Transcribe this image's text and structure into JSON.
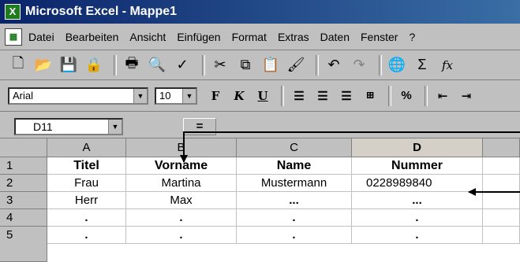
{
  "window": {
    "title": "Microsoft Excel - Mappe1",
    "app_icon": "X"
  },
  "menu": {
    "items": [
      "Datei",
      "Bearbeiten",
      "Ansicht",
      "Einfügen",
      "Format",
      "Extras",
      "Daten",
      "Fenster",
      "?"
    ]
  },
  "toolbar": {
    "icons": [
      "new-icon",
      "open-icon",
      "save-icon",
      "permission-icon",
      "print-icon",
      "print-preview-icon",
      "spelling-icon",
      "cut-icon",
      "copy-icon",
      "paste-icon",
      "format-painter-icon",
      "undo-icon",
      "redo-icon",
      "hyperlink-icon",
      "autosum-icon",
      "function-icon"
    ]
  },
  "formatting": {
    "font": "Arial",
    "size": "10",
    "bold": "F",
    "italic": "K",
    "underline": "U",
    "percent": "%"
  },
  "formula_bar": {
    "cell_ref": "D11",
    "equals": "="
  },
  "sheet": {
    "columns": [
      "A",
      "B",
      "C",
      "D"
    ],
    "rows": [
      "1",
      "2",
      "3",
      "4",
      "5"
    ],
    "cells": [
      [
        "Titel",
        "Vorname",
        "Name",
        "Nummer"
      ],
      [
        "Frau",
        "Martina",
        "Mustermann",
        "0228989840"
      ],
      [
        "Herr",
        "Max",
        "...",
        "..."
      ],
      [
        ".",
        ".",
        ".",
        "."
      ],
      [
        ".",
        ".",
        ".",
        "."
      ]
    ]
  }
}
